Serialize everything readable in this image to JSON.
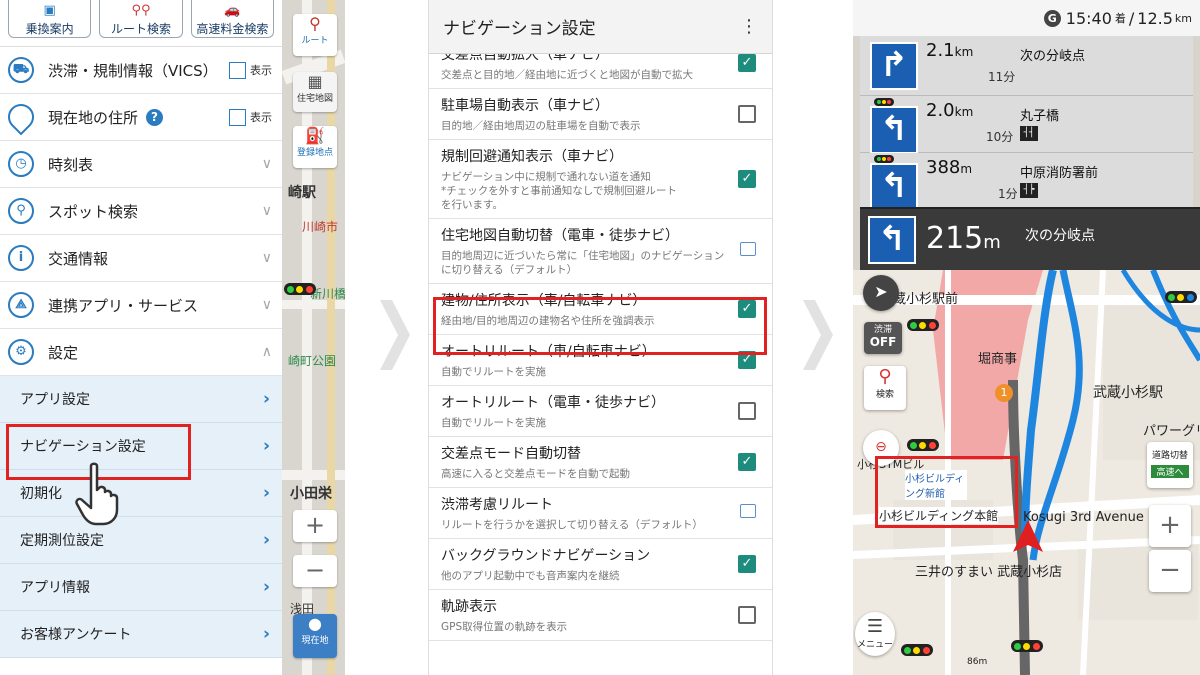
{
  "panel1": {
    "top_buttons": [
      {
        "label": "乗換案内",
        "icon": "train-icon"
      },
      {
        "label": "ルート検索",
        "icon": "route-pin-icon"
      },
      {
        "label": "高速料金検索",
        "icon": "car-icon"
      }
    ],
    "menu_items": [
      {
        "label": "渋滞・規制情報（VICS）",
        "icon": "traffic-car-icon",
        "checkbox_label": "表示"
      },
      {
        "label": "現在地の住所",
        "icon": "location-pin-icon",
        "checkbox_label": "表示",
        "help": "?"
      },
      {
        "label": "時刻表",
        "icon": "clock-icon"
      },
      {
        "label": "スポット検索",
        "icon": "search-icon"
      },
      {
        "label": "交通情報",
        "icon": "info-icon"
      },
      {
        "label": "連携アプリ・サービス",
        "icon": "share-icon"
      },
      {
        "label": "設定",
        "icon": "gear-icon"
      }
    ],
    "sub_items": [
      "アプリ設定",
      "ナビゲーション設定",
      "初期化",
      "定期測位設定",
      "アプリ情報",
      "お客様アンケート"
    ],
    "map": {
      "route_btn": "ルート",
      "house_map": "住宅地図",
      "register_btn": "登録地点",
      "station_label": "崎駅",
      "kawasaki": "川崎市",
      "shinkawa": "新川橋",
      "park": "崎町公園",
      "odakyu": "小田栄",
      "asada": "浅田",
      "zoom_in": "+",
      "zoom_out": "−",
      "current_btn": "現在地"
    }
  },
  "panel2": {
    "title": "ナビゲーション設定",
    "items": [
      {
        "title": "交差点自動拡大（車ナビ）",
        "desc": "交差点と目的地／経由地に近づくと地図が自動で拡大",
        "control": "checked"
      },
      {
        "title": "駐車場自動表示（車ナビ）",
        "desc": "目的地／経由地周辺の駐車場を自動で表示",
        "control": "unchecked"
      },
      {
        "title": "規制回避通知表示（車ナビ）",
        "desc": "ナビゲーション中に規制で通れない道を通知\n*チェックを外すと事前通知なしで規制回避ルート\nを行います。",
        "control": "checked"
      },
      {
        "title": "住宅地図自動切替（電車・徒歩ナビ）",
        "desc": "目的地周辺に近づいたら常に「住宅地図」のナビゲーション\nに切り替える（デフォルト）",
        "control": "external"
      },
      {
        "title": "建物/住所表示（車/自転車ナビ）",
        "desc": "経由地/目的地周辺の建物名や住所を強調表示",
        "control": "checked"
      },
      {
        "title": "オートリルート（車/自転車ナビ）",
        "desc": "自動でリルートを実施",
        "control": "checked"
      },
      {
        "title": "オートリルート（電車・徒歩ナビ）",
        "desc": "自動でリルートを実施",
        "control": "unchecked"
      },
      {
        "title": "交差点モード自動切替",
        "desc": "高速に入ると交差点モードを自動で起動",
        "control": "checked"
      },
      {
        "title": "渋滞考慮リルート",
        "desc": "リルートを行うかを選択して切り替える（デフォルト）",
        "control": "external"
      },
      {
        "title": "バックグラウンドナビゲーション",
        "desc": "他のアプリ起動中でも音声案内を継続",
        "control": "checked"
      },
      {
        "title": "軌跡表示",
        "desc": "GPS取得位置の軌跡を表示",
        "control": "unchecked"
      }
    ]
  },
  "panel3": {
    "status": {
      "badge": "G",
      "time": "15:40",
      "arrive": "着",
      "sep": "/",
      "distance": "12.5",
      "unit": "km"
    },
    "cards": [
      {
        "dist": "2.1",
        "unit": "km",
        "name": "次の分岐点",
        "time": "11分",
        "arrow": "↱",
        "lanes": ""
      },
      {
        "dist": "2.0",
        "unit": "km",
        "name": "丸子橋",
        "time": "10分",
        "arrow": "↰",
        "lanes": "┤┤"
      },
      {
        "dist": "388",
        "unit": "m",
        "name": "中原消防署前",
        "time": "1分",
        "arrow": "↰",
        "lanes": "┤┝"
      }
    ],
    "main": {
      "dist": "215",
      "unit": "m",
      "name": "次の分岐点",
      "arrow": "↰"
    },
    "buttons": {
      "jam": "渋滞",
      "jam_state": "OFF",
      "search": "検索",
      "menu": "メニュー",
      "road_switch": "道路切替",
      "highway": "高速へ",
      "zoom_in": "+",
      "zoom_out": "−"
    },
    "labels": {
      "station": "蔵小杉駅前",
      "shop": "堀商事",
      "musashi": "武蔵小杉駅",
      "tower": "パワーグリ",
      "stm": "小杉STMビル",
      "bld_short": "小杉ビルディング新館",
      "bld_main": "小杉ビルディング本館",
      "kosugi_ave": "Kosugi 3rd Avenue",
      "mitsui": "三井のすまい 武蔵小杉店",
      "scale": "86m",
      "waypoint": "1"
    }
  }
}
